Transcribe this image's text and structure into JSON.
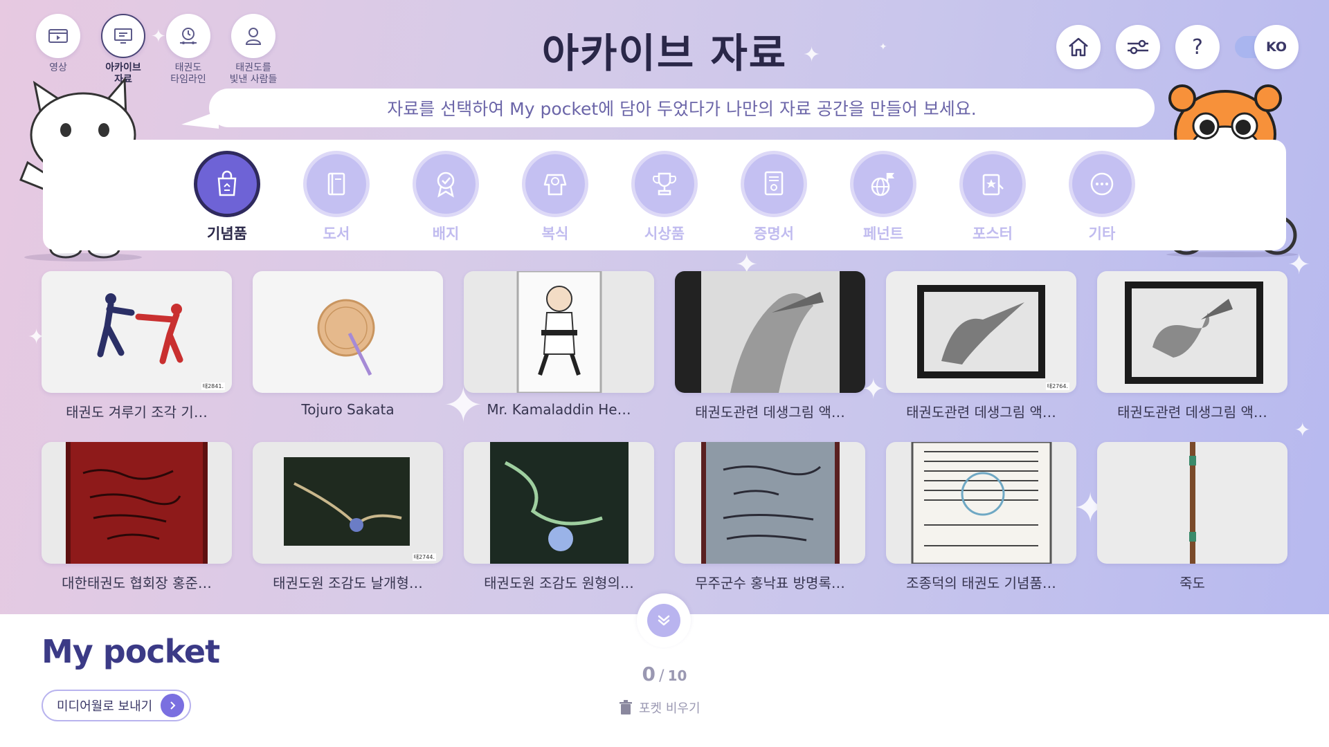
{
  "nav": {
    "items": [
      {
        "label": "영상",
        "icon": "video-icon"
      },
      {
        "label": "아카이브\n자료",
        "icon": "archive-icon",
        "active": true
      },
      {
        "label": "태권도\n타임라인",
        "icon": "timeline-icon"
      },
      {
        "label": "태권도를\n빛낸 사람들",
        "icon": "person-icon"
      }
    ]
  },
  "page": {
    "title": "아카이브 자료",
    "instruction": "자료를 선택하여 My pocket에 담아 두었다가 나만의 자료 공간을 만들어 보세요."
  },
  "topright": {
    "language": "KO"
  },
  "categories": [
    {
      "label": "기념품",
      "active": true
    },
    {
      "label": "도서"
    },
    {
      "label": "배지"
    },
    {
      "label": "복식"
    },
    {
      "label": "시상품"
    },
    {
      "label": "증명서"
    },
    {
      "label": "페넌트"
    },
    {
      "label": "포스터"
    },
    {
      "label": "기타"
    }
  ],
  "items": [
    {
      "title": "태권도 겨루기 조각 기…",
      "catno": "태2841."
    },
    {
      "title": "Tojuro Sakata"
    },
    {
      "title": "Mr. Kamaladdin He…"
    },
    {
      "title": "태권도관련 데생그림 액…"
    },
    {
      "title": "태권도관련 데생그림 액…",
      "catno": "태2764."
    },
    {
      "title": "태권도관련 데생그림 액…"
    },
    {
      "title": "대한태권도 협회장 홍준…"
    },
    {
      "title": "태권도원 조감도 날개형…",
      "catno": "태2744."
    },
    {
      "title": "태권도원 조감도 원형의…"
    },
    {
      "title": "무주군수 홍낙표 방명록…"
    },
    {
      "title": "조종덕의 태권도 기념품…"
    },
    {
      "title": "죽도"
    }
  ],
  "pocket": {
    "title": "My pocket",
    "send_label": "미디어월로 보내기",
    "count": "0",
    "slash": "/",
    "total": "10",
    "empty_label": "포켓 비우기"
  },
  "colors": {
    "accent": "#6e63d6",
    "accent_light": "#c4c0f2",
    "title_dark": "#2a2748"
  }
}
